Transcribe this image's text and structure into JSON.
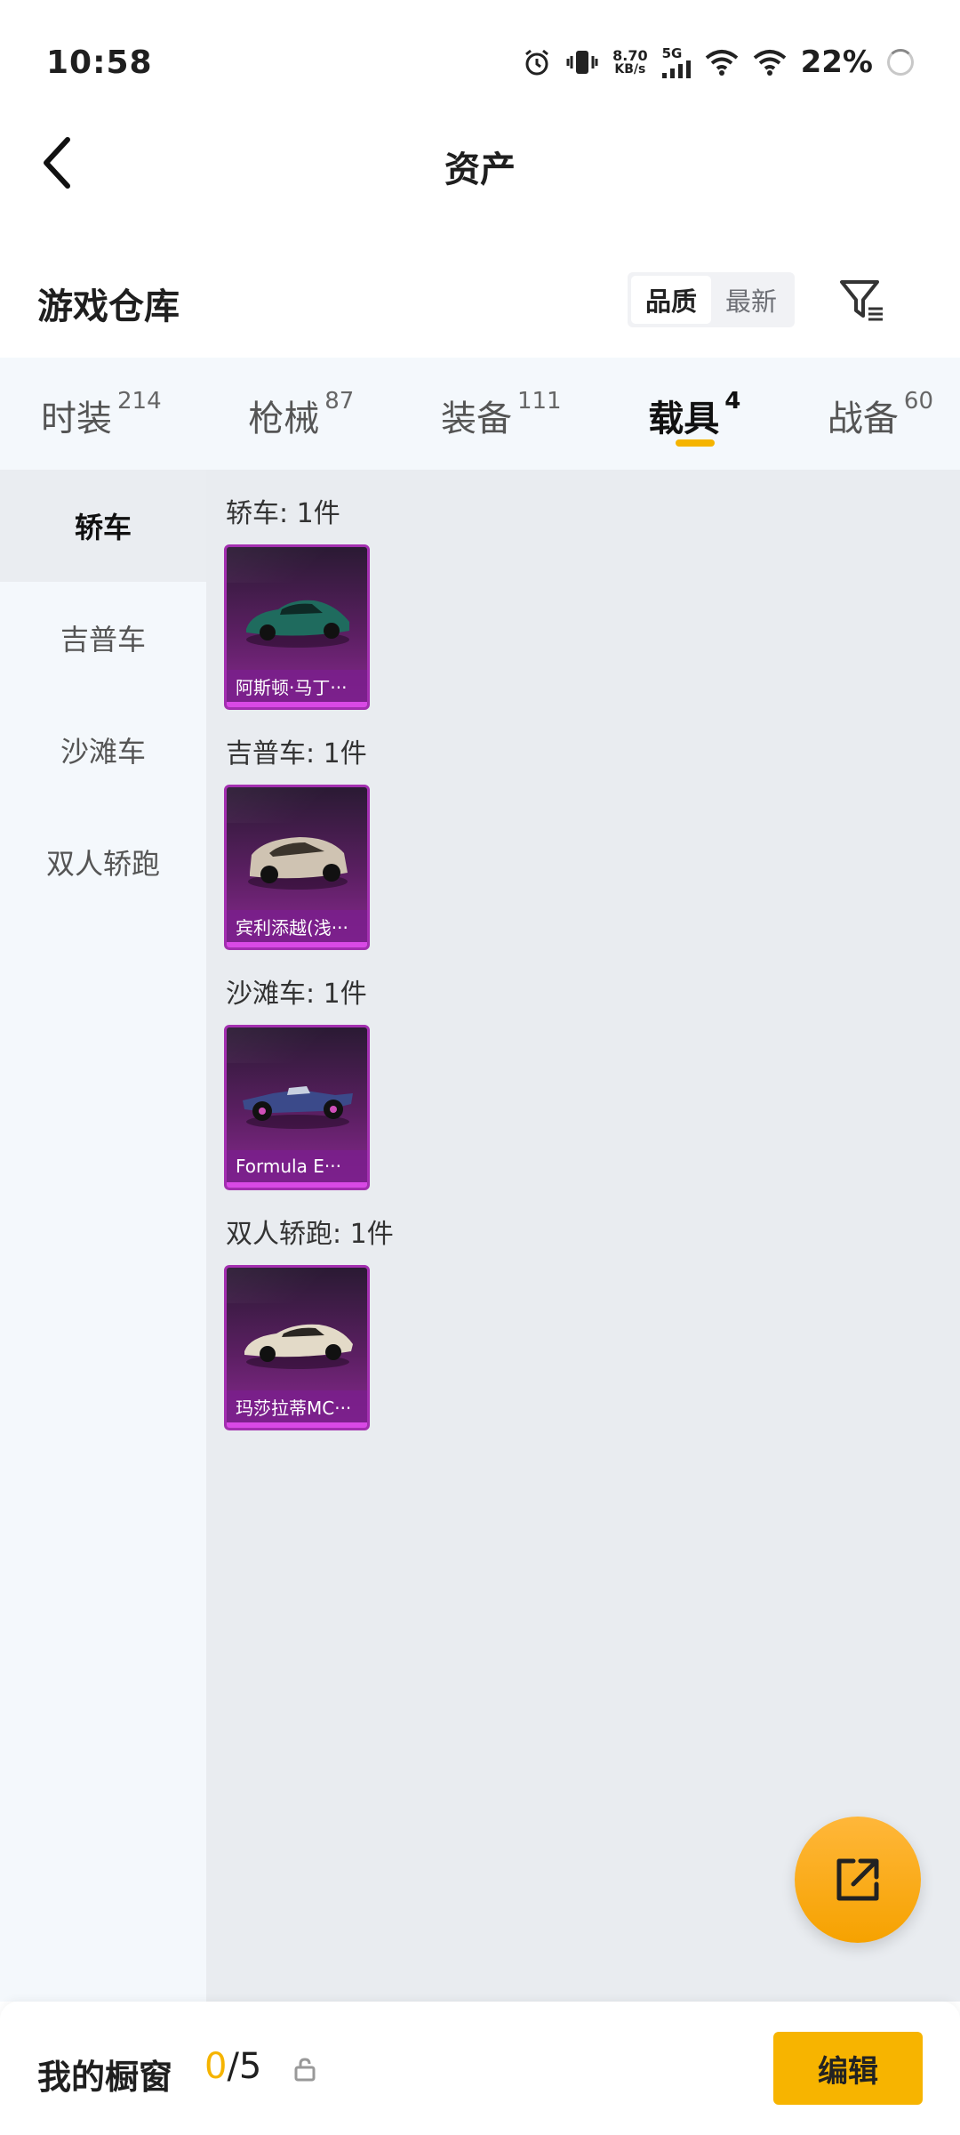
{
  "status_bar": {
    "time": "10:58",
    "speed_value": "8.70",
    "speed_unit": "KB/s",
    "network": "5G",
    "battery": "22%"
  },
  "header": {
    "title": "资产"
  },
  "section": {
    "title": "游戏仓库",
    "sort_options": [
      "品质",
      "最新"
    ],
    "sort_selected": "品质"
  },
  "tabs": [
    {
      "label": "时装",
      "count": "214",
      "active": false
    },
    {
      "label": "枪械",
      "count": "87",
      "active": false
    },
    {
      "label": "装备",
      "count": "111",
      "active": false
    },
    {
      "label": "载具",
      "count": "4",
      "active": true
    },
    {
      "label": "战备",
      "count": "60",
      "active": false
    }
  ],
  "side_nav": [
    {
      "label": "轿车",
      "active": true
    },
    {
      "label": "吉普车",
      "active": false
    },
    {
      "label": "沙滩车",
      "active": false
    },
    {
      "label": "双人轿跑",
      "active": false
    }
  ],
  "groups": [
    {
      "label": "轿车: 1件",
      "item_name": "阿斯顿·马丁···",
      "car_color": "#1f6b5e"
    },
    {
      "label": "吉普车: 1件",
      "item_name": "宾利添越(浅···",
      "car_color": "#cfc3b2"
    },
    {
      "label": "沙滩车: 1件",
      "item_name": "Formula E···",
      "car_color": "#3b4a8a"
    },
    {
      "label": "双人轿跑: 1件",
      "item_name": "玛莎拉蒂MC···",
      "car_color": "#e3dac8"
    }
  ],
  "bottom_bar": {
    "label": "我的橱窗",
    "count_current": "0",
    "count_total": "/5",
    "edit_label": "编辑"
  },
  "colors": {
    "accent": "#f5b400",
    "card_purple": "#8a2a91"
  },
  "icons": [
    "back-arrow-icon",
    "filter-icon",
    "share-out-icon",
    "lock-icon",
    "alarm-icon",
    "vibrate-icon",
    "wifi-icon",
    "signal-icon"
  ]
}
